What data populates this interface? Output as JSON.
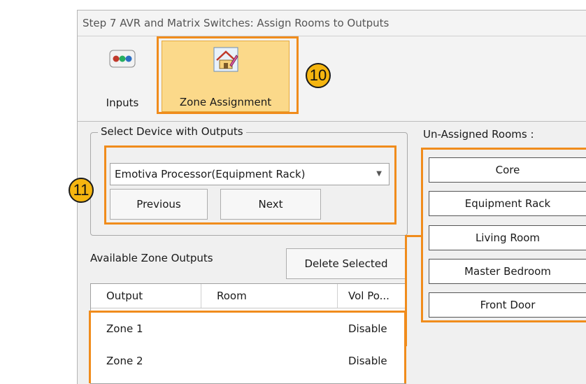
{
  "window": {
    "title": "Step 7 AVR and Matrix Switches: Assign Rooms to Outputs"
  },
  "ribbon": {
    "inputs_label": "Inputs",
    "zone_assignment_label": "Zone Assignment"
  },
  "callouts": {
    "zone_badge": "10",
    "device_badge": "11"
  },
  "device_group": {
    "title": "Select Device with Outputs",
    "selected_device": "Emotiva Processor(Equipment Rack)",
    "previous_label": "Previous",
    "next_label": "Next"
  },
  "zone_outputs": {
    "label": "Available Zone Outputs",
    "delete_label": "Delete Selected",
    "columns": [
      "Output",
      "Room",
      "Vol Po..."
    ],
    "rows": [
      {
        "output": "Zone 1",
        "room": "",
        "vol": "Disable"
      },
      {
        "output": "Zone 2",
        "room": "",
        "vol": "Disable"
      }
    ]
  },
  "unassigned": {
    "label": "Un-Assigned Rooms :",
    "rooms": [
      "Core",
      "Equipment Rack",
      "Living Room",
      "Master Bedroom",
      "Front Door"
    ]
  },
  "colors": {
    "highlight": "#f08c1c",
    "badge": "#f5b50f",
    "ribbon_selected": "#fbd98a"
  },
  "icons": [
    "inputs-dots-icon",
    "zone-house-pencil-icon",
    "combo-arrow-icon"
  ]
}
